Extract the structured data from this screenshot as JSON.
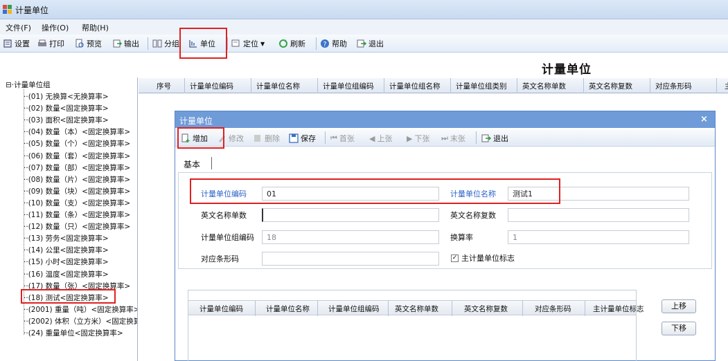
{
  "app": {
    "title": "计量单位"
  },
  "menu": [
    "文件(F)",
    "操作(O)",
    "帮助(H)"
  ],
  "toolbar": {
    "settings": "设置",
    "print": "打印",
    "preview": "预览",
    "export": "输出",
    "group": "分组",
    "unit": "单位",
    "locate": "定位",
    "refresh": "刷新",
    "help": "帮助",
    "exit": "退出"
  },
  "page_heading": "计量单位",
  "tree": {
    "root": "计量单位组",
    "items": [
      "(01) 无换算<无换算率>",
      "(02) 数量<固定换算率>",
      "(03) 面积<固定换算率>",
      "(04) 数量（本）<固定换算率>",
      "(05) 数量（个）<固定换算率>",
      "(06) 数量（套）<固定换算率>",
      "(07) 数量（部）<固定换算率>",
      "(08) 数量（片）<固定换算率>",
      "(09) 数量（块）<固定换算率>",
      "(10) 数量（支）<固定换算率>",
      "(11) 数量（条）<固定换算率>",
      "(12) 数量（只）<固定换算率>",
      "(13) 劳务<固定换算率>",
      "(14) 公里<固定换算率>",
      "(15) 小时<固定换算率>",
      "(16) 温度<固定换算率>",
      "(17) 数量（张）<固定换算率>",
      "(18) 测试<固定换算率>",
      "(2001) 重量（吨）<固定换算率>",
      "(2002) 体积（立方米）<固定换算率>",
      "(24) 重量单位<固定换算率>"
    ]
  },
  "grid": {
    "columns": [
      "序号",
      "计量单位编码",
      "计量单位名称",
      "计量单位组编码",
      "计量单位组名称",
      "计量单位组类别",
      "英文名称单数",
      "英文名称复数",
      "对应条形码",
      "主"
    ]
  },
  "dialog": {
    "title": "计量单位",
    "close": "×",
    "toolbar": {
      "add": "增加",
      "edit": "修改",
      "delete": "删除",
      "save": "保存",
      "first": "首张",
      "prev": "上张",
      "next": "下张",
      "last": "末张",
      "exit": "退出"
    },
    "tab": "基本",
    "form": {
      "code_label": "计量单位编码",
      "code_value": "01",
      "name_label": "计量单位名称",
      "name_value": "测试1",
      "en_single_label": "英文名称单数",
      "en_single_value": "",
      "en_plural_label": "英文名称复数",
      "en_plural_value": "",
      "group_code_label": "计量单位组编码",
      "group_code_value": "18",
      "rate_label": "换算率",
      "rate_value": "1",
      "barcode_label": "对应条形码",
      "barcode_value": "",
      "main_flag_label": "主计量单位标志",
      "main_flag_checked": true
    },
    "subgrid": {
      "columns": [
        "计量单位编码",
        "计量单位名称",
        "计量单位组编码",
        "英文名称单数",
        "英文名称复数",
        "对应条形码",
        "主计量单位标志"
      ]
    },
    "move_up": "上移",
    "move_down": "下移"
  }
}
